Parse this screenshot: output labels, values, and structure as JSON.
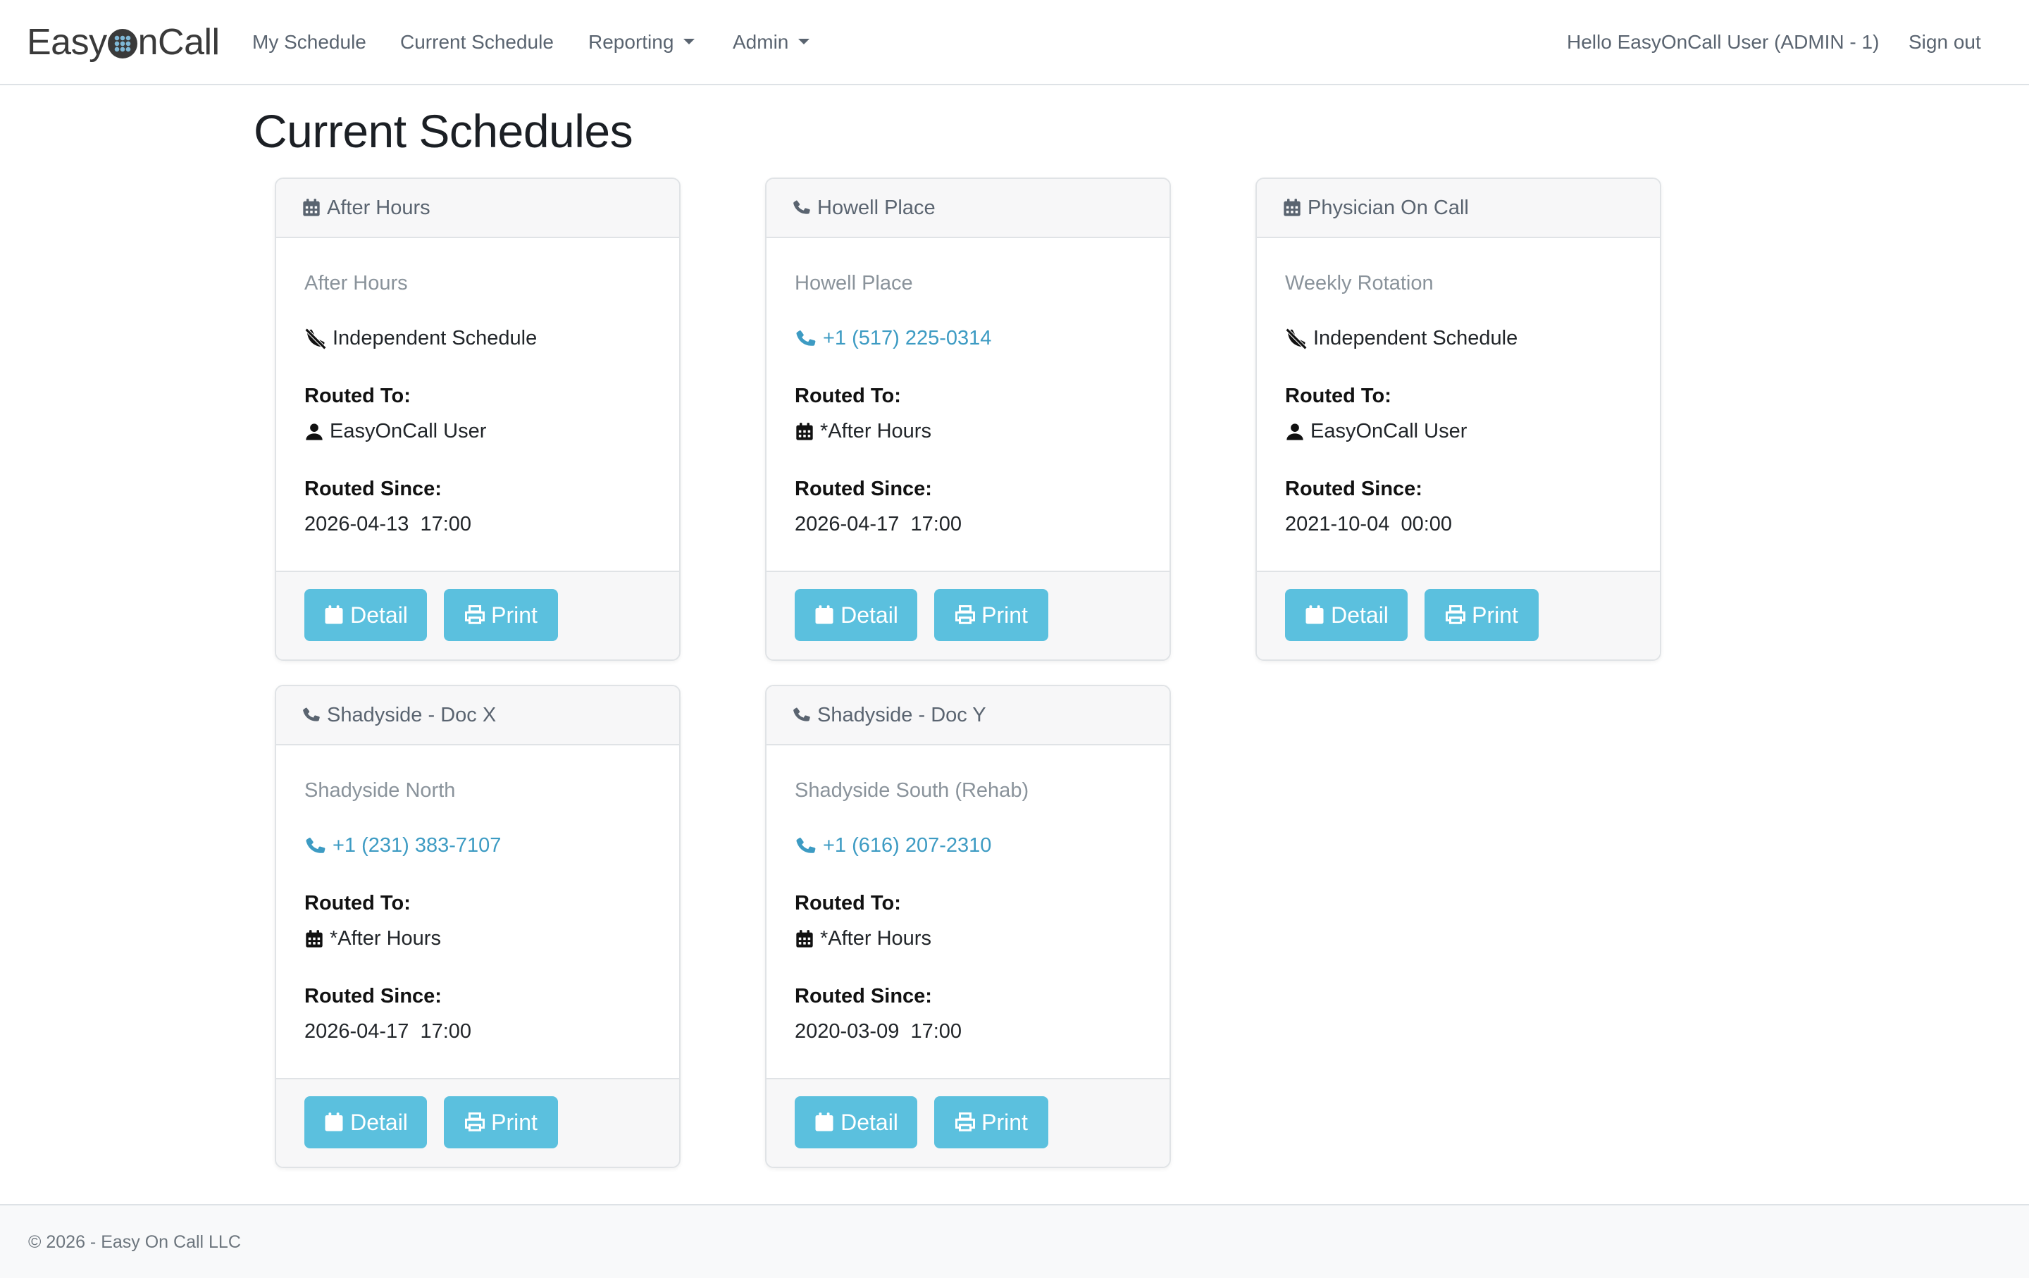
{
  "brand": {
    "before": "Easy",
    "after": "nCall"
  },
  "nav": {
    "my_schedule": "My Schedule",
    "current_schedule": "Current Schedule",
    "reporting": "Reporting",
    "admin": "Admin",
    "greeting": "Hello EasyOnCall User (ADMIN - 1)",
    "sign_out": "Sign out"
  },
  "page": {
    "title": "Current Schedules"
  },
  "labels": {
    "routed_to": "Routed To:",
    "routed_since": "Routed Since:",
    "detail": "Detail",
    "print": "Print"
  },
  "cards": [
    {
      "header_icon": "calendar-icon",
      "title": "After Hours",
      "subtitle": "After Hours",
      "number_icon": "phone-slash-icon",
      "number": "Independent Schedule",
      "routed_icon": "user-icon",
      "routed_to": "EasyOnCall User",
      "routed_since": "2026-04-13  17:00"
    },
    {
      "header_icon": "phone-icon",
      "title": "Howell Place",
      "subtitle": "Howell Place",
      "number_icon": "phone-icon",
      "number": "+1 (517) 225-0314",
      "routed_icon": "calendar-icon",
      "routed_to": "*After Hours",
      "routed_since": "2026-04-17  17:00"
    },
    {
      "header_icon": "calendar-icon",
      "title": "Physician On Call",
      "subtitle": "Weekly Rotation",
      "number_icon": "phone-slash-icon",
      "number": "Independent Schedule",
      "routed_icon": "user-icon",
      "routed_to": "EasyOnCall User",
      "routed_since": "2021-10-04  00:00"
    },
    {
      "header_icon": "phone-icon",
      "title": "Shadyside - Doc X",
      "subtitle": "Shadyside North",
      "number_icon": "phone-icon",
      "number": "+1 (231) 383-7107",
      "routed_icon": "calendar-icon",
      "routed_to": "*After Hours",
      "routed_since": "2026-04-17  17:00"
    },
    {
      "header_icon": "phone-icon",
      "title": "Shadyside - Doc Y",
      "subtitle": "Shadyside South (Rehab)",
      "number_icon": "phone-icon",
      "number": "+1 (616) 207-2310",
      "routed_icon": "calendar-icon",
      "routed_to": "*After Hours",
      "routed_since": "2020-03-09  17:00"
    }
  ],
  "colors": {
    "button": "#5bc0de",
    "link": "#3d9bc3",
    "muted": "#8a939b"
  },
  "footer": {
    "text": "© 2026 - Easy On Call LLC"
  }
}
